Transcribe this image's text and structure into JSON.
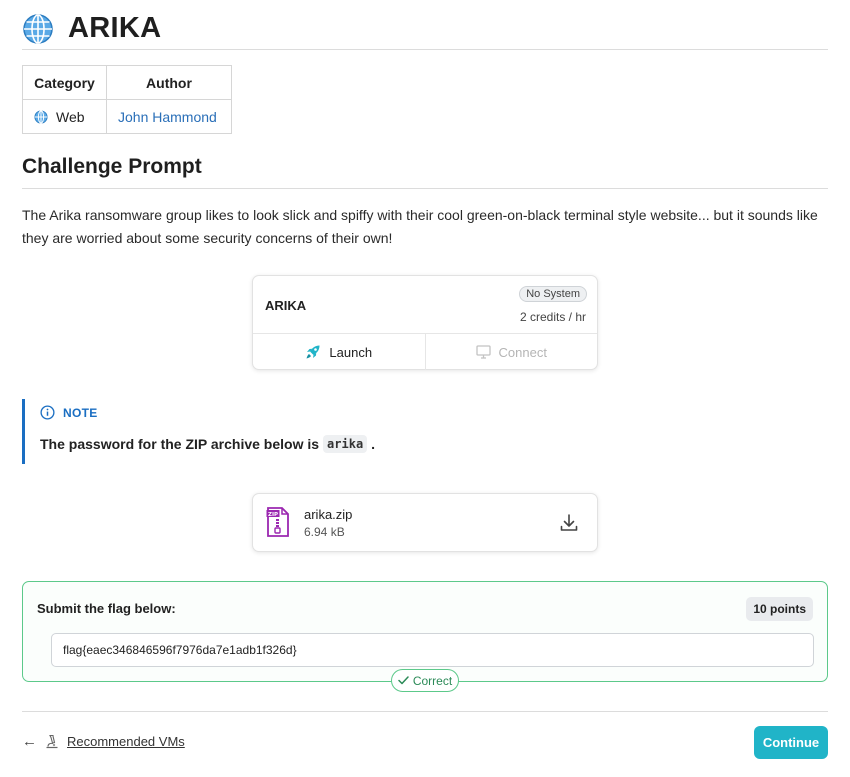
{
  "page": {
    "title": "ARIKA",
    "title_icon": "globe-icon"
  },
  "meta_table": {
    "headers": {
      "category": "Category",
      "author": "Author"
    },
    "category": {
      "label": "Web",
      "icon": "globe-icon"
    },
    "author": "John Hammond"
  },
  "challenge": {
    "section_title": "Challenge Prompt",
    "prompt": "The Arika ransomware group likes to look slick and spiffy with their cool green-on-black terminal style website... but it sounds like they are worried about some security concerns of their own!"
  },
  "vm": {
    "name": "ARIKA",
    "badge": "No System",
    "credits": "2 credits / hr",
    "launch_label": "Launch",
    "connect_label": "Connect"
  },
  "note": {
    "title": "NOTE",
    "text_before": "The password for the ZIP archive below is",
    "code": "arika",
    "text_after": "."
  },
  "file": {
    "name": "arika.zip",
    "size": "6.94 kB"
  },
  "flag": {
    "label": "Submit the flag below:",
    "points": "10 points",
    "value": "flag{eaec346846596f7976da7e1adb1f326d}",
    "status": "Correct"
  },
  "footer": {
    "back_link": "Recommended VMs",
    "continue_label": "Continue"
  },
  "colors": {
    "accent_blue": "#1a6ec2",
    "success_green": "#5cc98a",
    "continue_teal": "#20b4c8",
    "zip_purple": "#9b27b0"
  }
}
